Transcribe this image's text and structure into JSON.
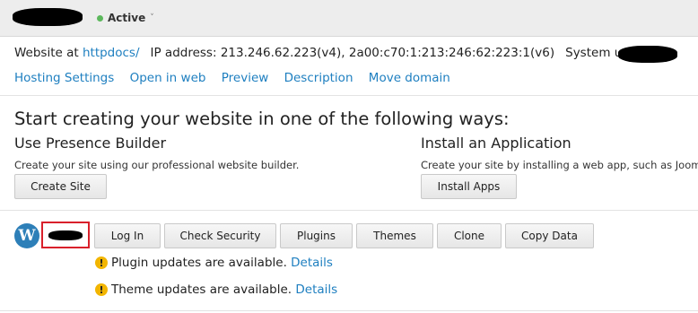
{
  "header": {
    "status_label": "Active",
    "status_caret": "˅"
  },
  "info": {
    "website_prefix": "Website at ",
    "website_path": "httpdocs/",
    "ip_label": "IP address: ",
    "ip_value": "213.246.62.223(v4), 2a00:c70:1:213:246:62:223:1(v6)",
    "system_user_label": "System user: "
  },
  "actions": [
    "Hosting Settings",
    "Open in web",
    "Preview",
    "Description",
    "Move domain"
  ],
  "create": {
    "heading": "Start creating your website in one of the following ways:",
    "presence": {
      "title": "Use Presence Builder",
      "description": "Create your site using our professional website builder.",
      "button": "Create Site"
    },
    "app": {
      "title": "Install an Application",
      "description": "Create your site by installing a web app, such as Joomla",
      "button": "Install Apps"
    }
  },
  "wordpress": {
    "logo_letter": "W",
    "buttons": {
      "login": "Log In",
      "check_security": "Check Security",
      "plugins": "Plugins",
      "themes": "Themes",
      "clone": "Clone",
      "copy_data": "Copy Data"
    },
    "notices": {
      "plugin_text": "Plugin updates are available. ",
      "theme_text": "Theme updates are available. ",
      "details": "Details",
      "warn_symbol": "!"
    }
  }
}
